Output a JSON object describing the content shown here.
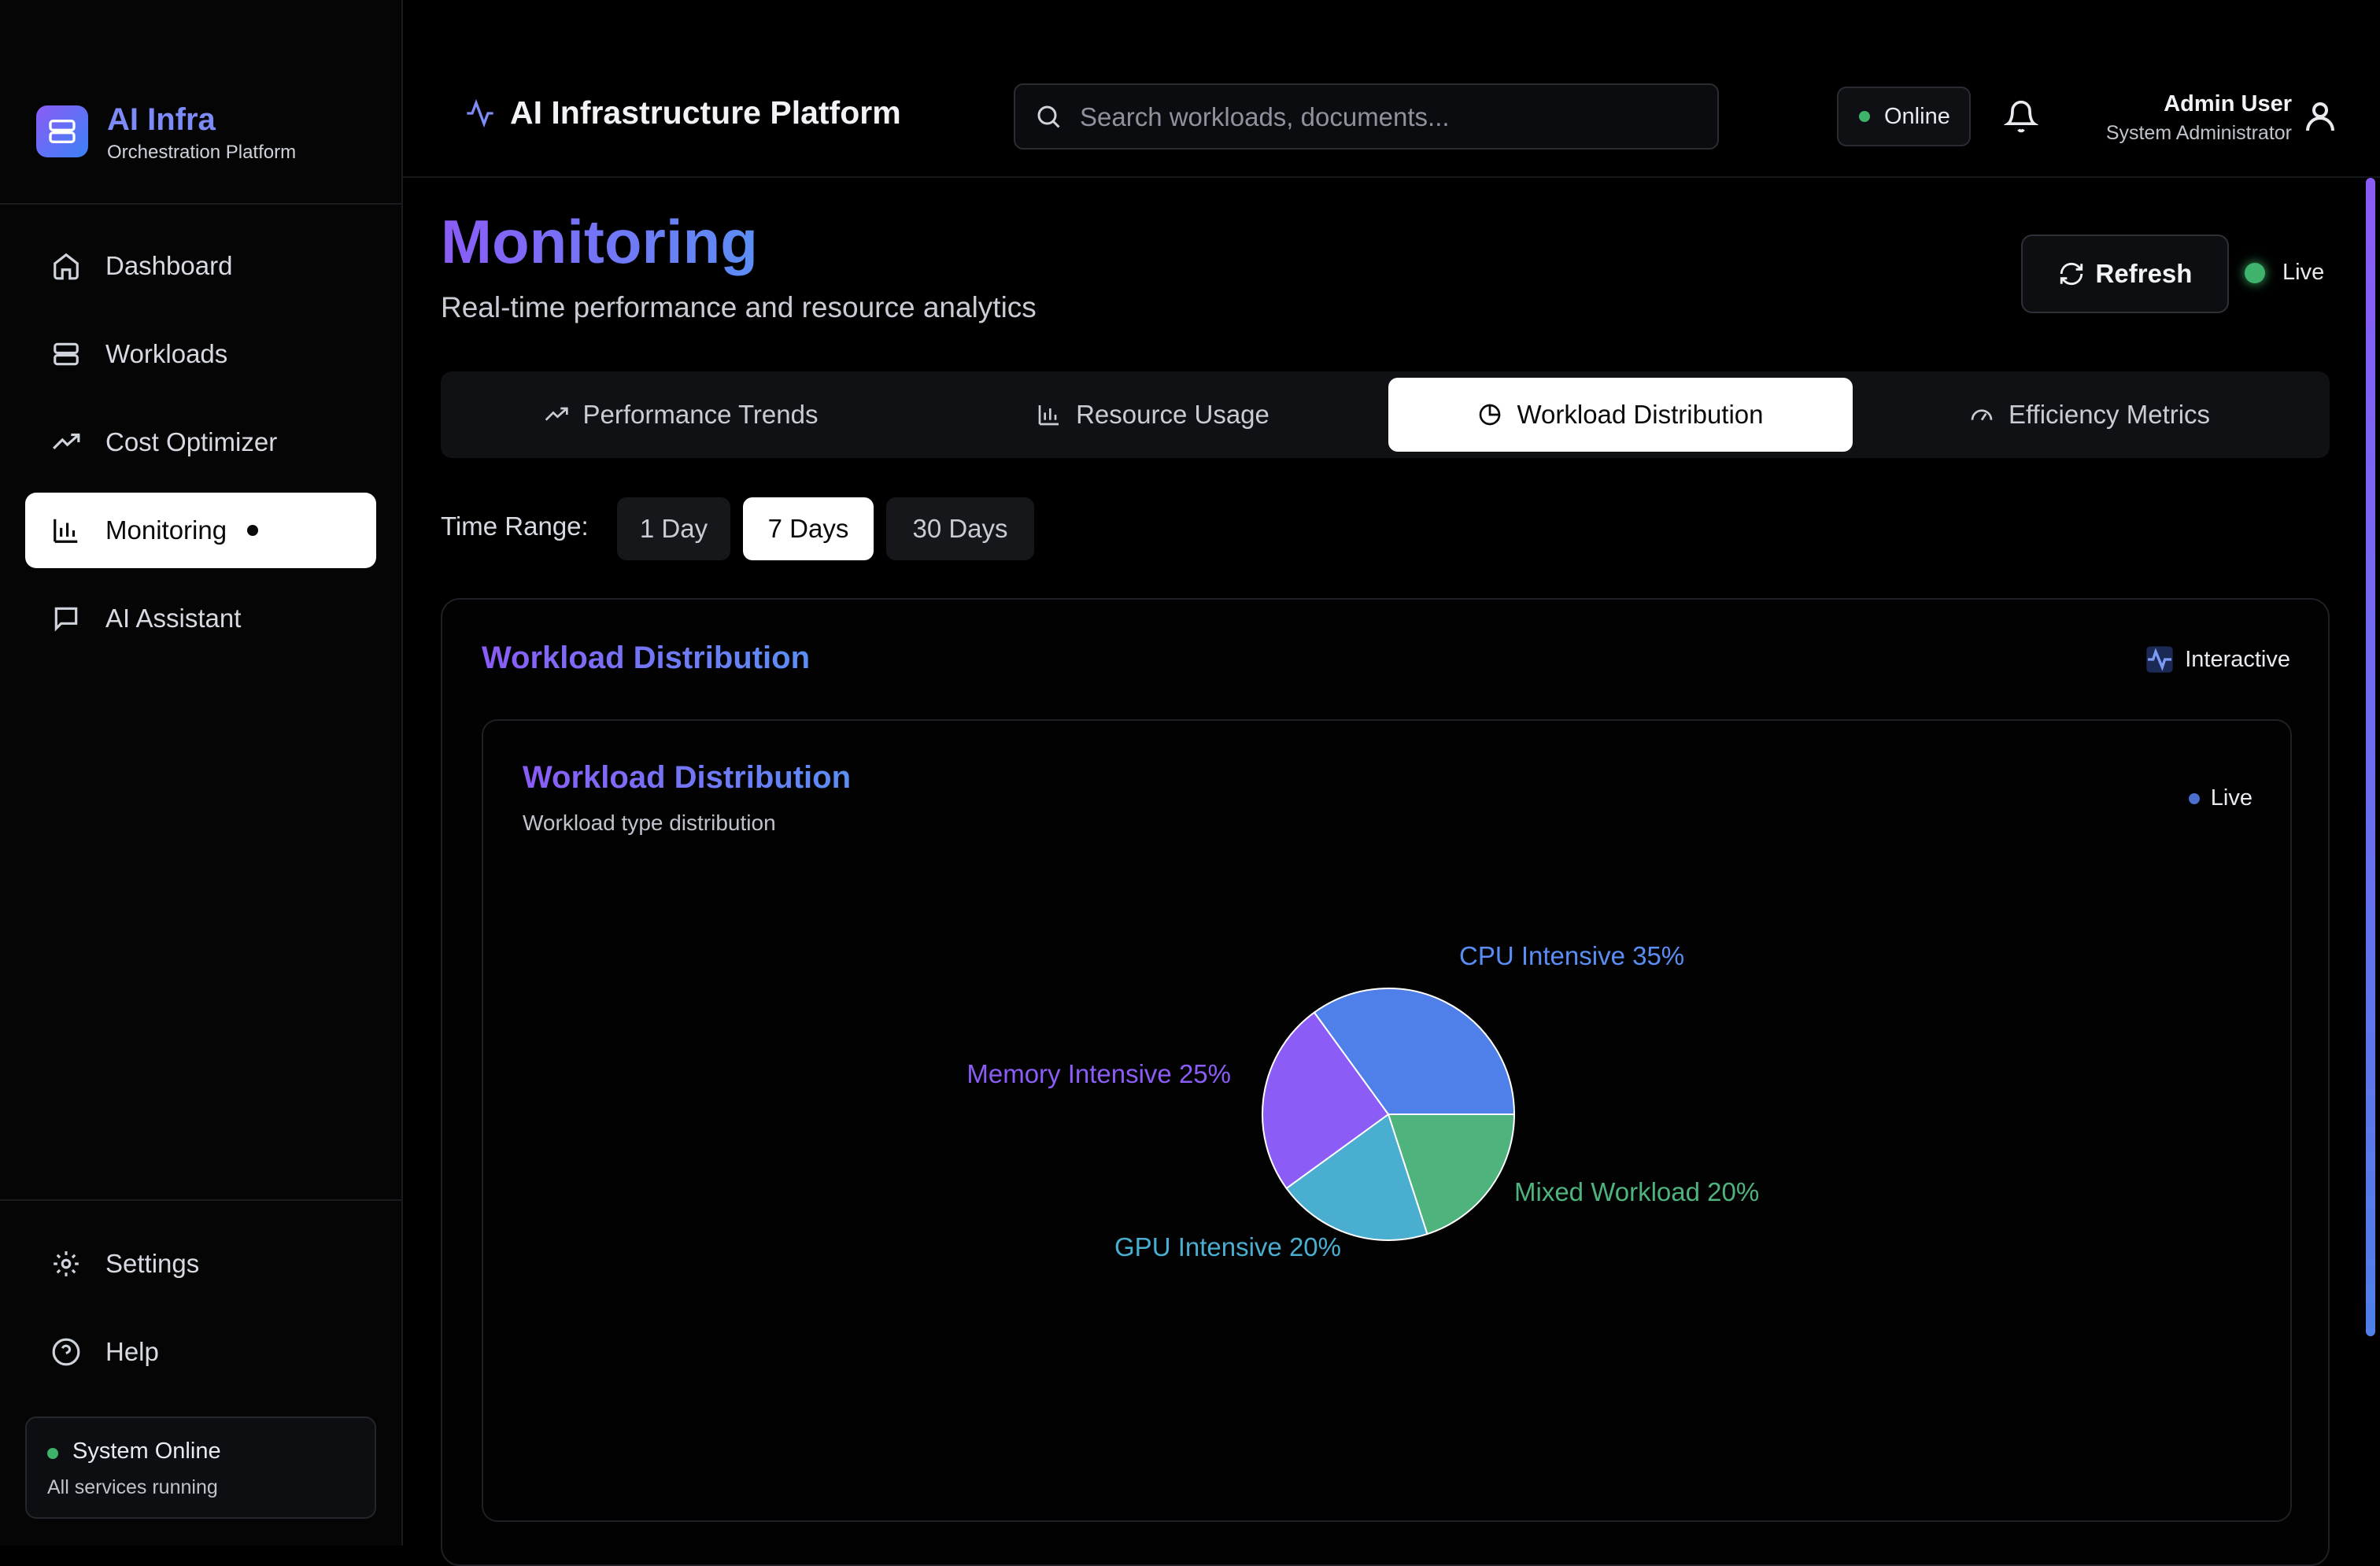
{
  "brand": {
    "title": "AI Infra",
    "subtitle": "Orchestration Platform"
  },
  "sidebar": {
    "items": [
      {
        "label": "Dashboard",
        "icon": "home-icon"
      },
      {
        "label": "Workloads",
        "icon": "server-icon"
      },
      {
        "label": "Cost Optimizer",
        "icon": "trending-up-icon"
      },
      {
        "label": "Monitoring",
        "icon": "bar-chart-icon",
        "active": true
      },
      {
        "label": "AI Assistant",
        "icon": "message-icon"
      }
    ],
    "bottom": [
      {
        "label": "Settings",
        "icon": "gear-icon"
      },
      {
        "label": "Help",
        "icon": "help-circle-icon"
      }
    ],
    "status": {
      "title": "System Online",
      "detail": "All services running"
    }
  },
  "header": {
    "title": "AI Infrastructure Platform",
    "search_placeholder": "Search workloads, documents...",
    "online_label": "Online",
    "user_name": "Admin User",
    "user_role": "System Administrator"
  },
  "page": {
    "title": "Monitoring",
    "subtitle": "Real-time performance and resource analytics",
    "refresh_label": "Refresh",
    "live_label": "Live"
  },
  "tabs": [
    {
      "label": "Performance Trends",
      "icon": "trending-up-icon"
    },
    {
      "label": "Resource Usage",
      "icon": "bar-chart-icon"
    },
    {
      "label": "Workload Distribution",
      "icon": "pie-chart-icon",
      "active": true
    },
    {
      "label": "Efficiency Metrics",
      "icon": "gauge-icon"
    }
  ],
  "time_range": {
    "label": "Time Range:",
    "options": [
      "1 Day",
      "7 Days",
      "30 Days"
    ],
    "selected": "7 Days"
  },
  "panel": {
    "title": "Workload Distribution",
    "interactive_label": "Interactive",
    "card_title": "Workload Distribution",
    "card_subtitle": "Workload type distribution",
    "card_live_label": "Live"
  },
  "colors": {
    "accent_purple": "#8b5cf6",
    "accent_blue": "#5b8ef5",
    "online_green": "#3fb36b"
  },
  "chart_data": {
    "type": "pie",
    "title": "",
    "slices": [
      {
        "label": "CPU Intensive",
        "value": 35,
        "color": "#4f7fe8",
        "label_color": "#5b8ef5"
      },
      {
        "label": "Mixed Workload",
        "value": 20,
        "color": "#4fb37d",
        "label_color": "#4fb37d"
      },
      {
        "label": "GPU Intensive",
        "value": 20,
        "color": "#4aaed0",
        "label_color": "#4aaed0"
      },
      {
        "label": "Memory Intensive",
        "value": 25,
        "color": "#8b5cf6",
        "label_color": "#8b5cf6"
      }
    ]
  }
}
